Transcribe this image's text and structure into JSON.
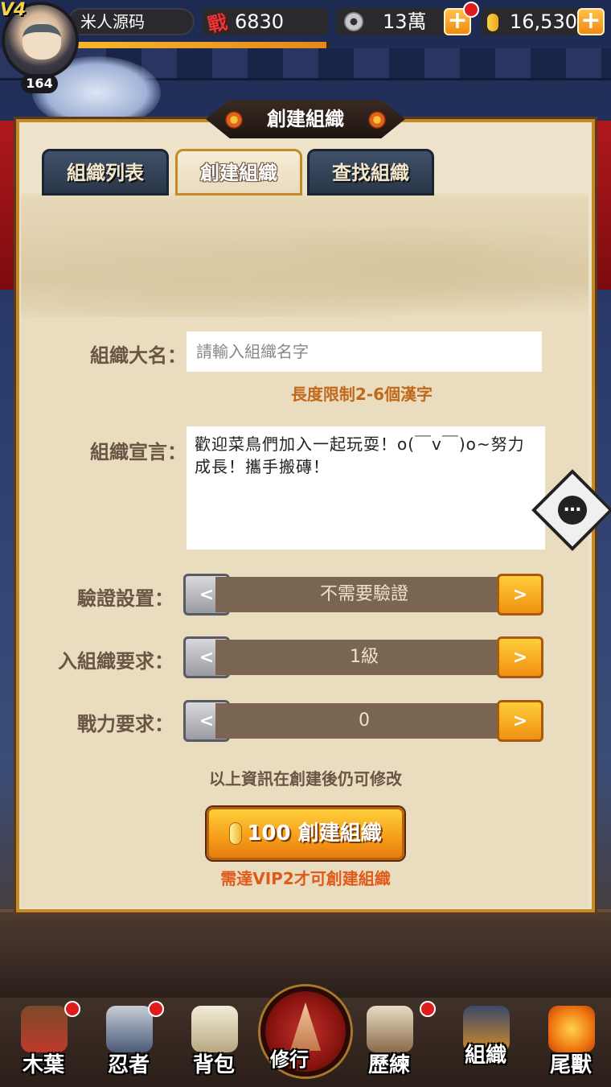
{
  "header": {
    "vip_label": "V4",
    "level": "164",
    "player_name": "米人源码",
    "power_value": "6830",
    "power_icon_char": "戰",
    "coins_value": "13萬",
    "gold_value": "16,530",
    "plus_char": "+"
  },
  "panel": {
    "title": "創建組織",
    "tabs": [
      {
        "label": "組織列表"
      },
      {
        "label": "創建組織"
      },
      {
        "label": "查找組織"
      }
    ]
  },
  "form": {
    "name_label": "組織大名：",
    "name_placeholder": "請輸入組織名字",
    "name_hint": "長度限制2-6個漢字",
    "motto_label": "組織宣言：",
    "motto_text": "歡迎菜鳥們加入一起玩耍！o(￣v￣)o~努力成長！攜手搬磚！",
    "verify_label": "驗證設置：",
    "verify_value": "不需要驗證",
    "level_label": "入組織要求：",
    "level_value": "1級",
    "power_label": "戰力要求：",
    "power_value": "0",
    "prev_char": "<",
    "next_char": ">",
    "note": "以上資訊在創建後仍可修改",
    "create_button_label": "100 創建組織",
    "vip_requirement": "需達VIP2才可創建組織"
  },
  "bottom_nav": {
    "items": [
      {
        "label": "木葉"
      },
      {
        "label": "忍者"
      },
      {
        "label": "背包"
      },
      {
        "label": "修行"
      },
      {
        "label": "歷練"
      },
      {
        "label": "組織"
      },
      {
        "label": "尾獸"
      }
    ]
  },
  "colors": {
    "accent_orange": "#f59c18",
    "panel_bg": "#ede3cb",
    "hint_text": "#c0691a",
    "vip_note": "#e05a1a",
    "badge_red": "#e01b1b"
  }
}
